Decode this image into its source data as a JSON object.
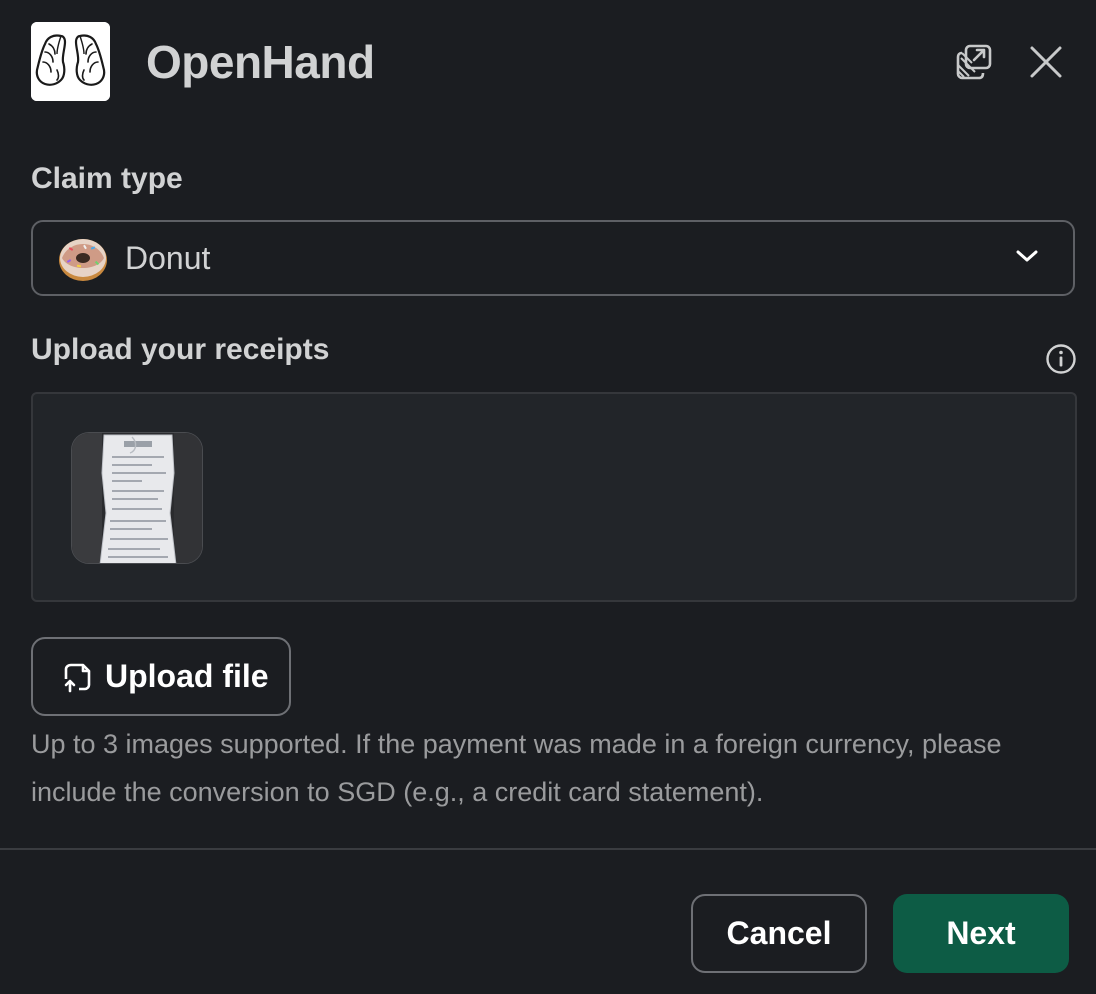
{
  "header": {
    "app_title": "OpenHand",
    "logo_icon": "praying-hands-logo",
    "popout_icon": "open-in-window-icon",
    "close_icon": "close-icon"
  },
  "claim_type": {
    "label": "Claim type",
    "selected_value": "Donut",
    "selected_icon": "donut-emoji"
  },
  "receipts": {
    "label": "Upload your receipts",
    "info_icon": "info-icon",
    "thumbnails": [
      {
        "kind": "receipt-photo"
      }
    ]
  },
  "upload": {
    "button_label": "Upload file",
    "hint": "Up to 3 images supported. If the payment was made in a foreign currency, please include the conversion to SGD (e.g., a credit card statement)."
  },
  "footer": {
    "cancel_label": "Cancel",
    "next_label": "Next"
  },
  "colors": {
    "background": "#1b1d21",
    "primary_button": "#0d5c45",
    "text": "#d1d2d3",
    "muted_text": "#9a9b9d"
  }
}
